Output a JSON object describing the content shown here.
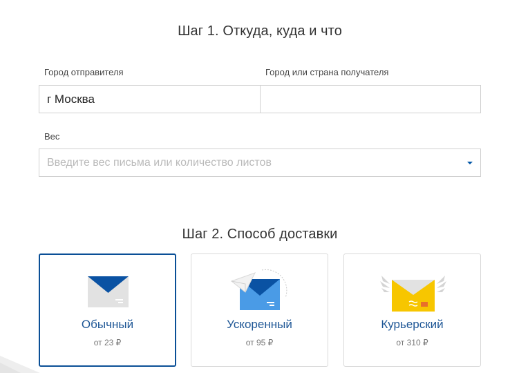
{
  "step1": {
    "title": "Шаг 1. Откуда, куда и что",
    "sender_label": "Город отправителя",
    "sender_value": "г Москва",
    "recipient_label": "Город или страна получателя",
    "recipient_value": "",
    "weight_label": "Вес",
    "weight_placeholder": "Введите вес письма или количество листов"
  },
  "step2": {
    "title": "Шаг 2. Способ доставки",
    "options": [
      {
        "name": "Обычный",
        "price": "от 23 ₽",
        "icon": "envelope-icon",
        "selected": true
      },
      {
        "name": "Ускоренный",
        "price": "от 95 ₽",
        "icon": "express-envelope-icon",
        "selected": false
      },
      {
        "name": "Курьерский",
        "price": "от 310 ₽",
        "icon": "winged-envelope-icon",
        "selected": false
      }
    ]
  },
  "colors": {
    "accent": "#0055a6",
    "selected_border": "#0a4f96",
    "option_text": "#1f5796",
    "express_blue": "#4a9be6",
    "courier_yellow": "#f7c600"
  }
}
